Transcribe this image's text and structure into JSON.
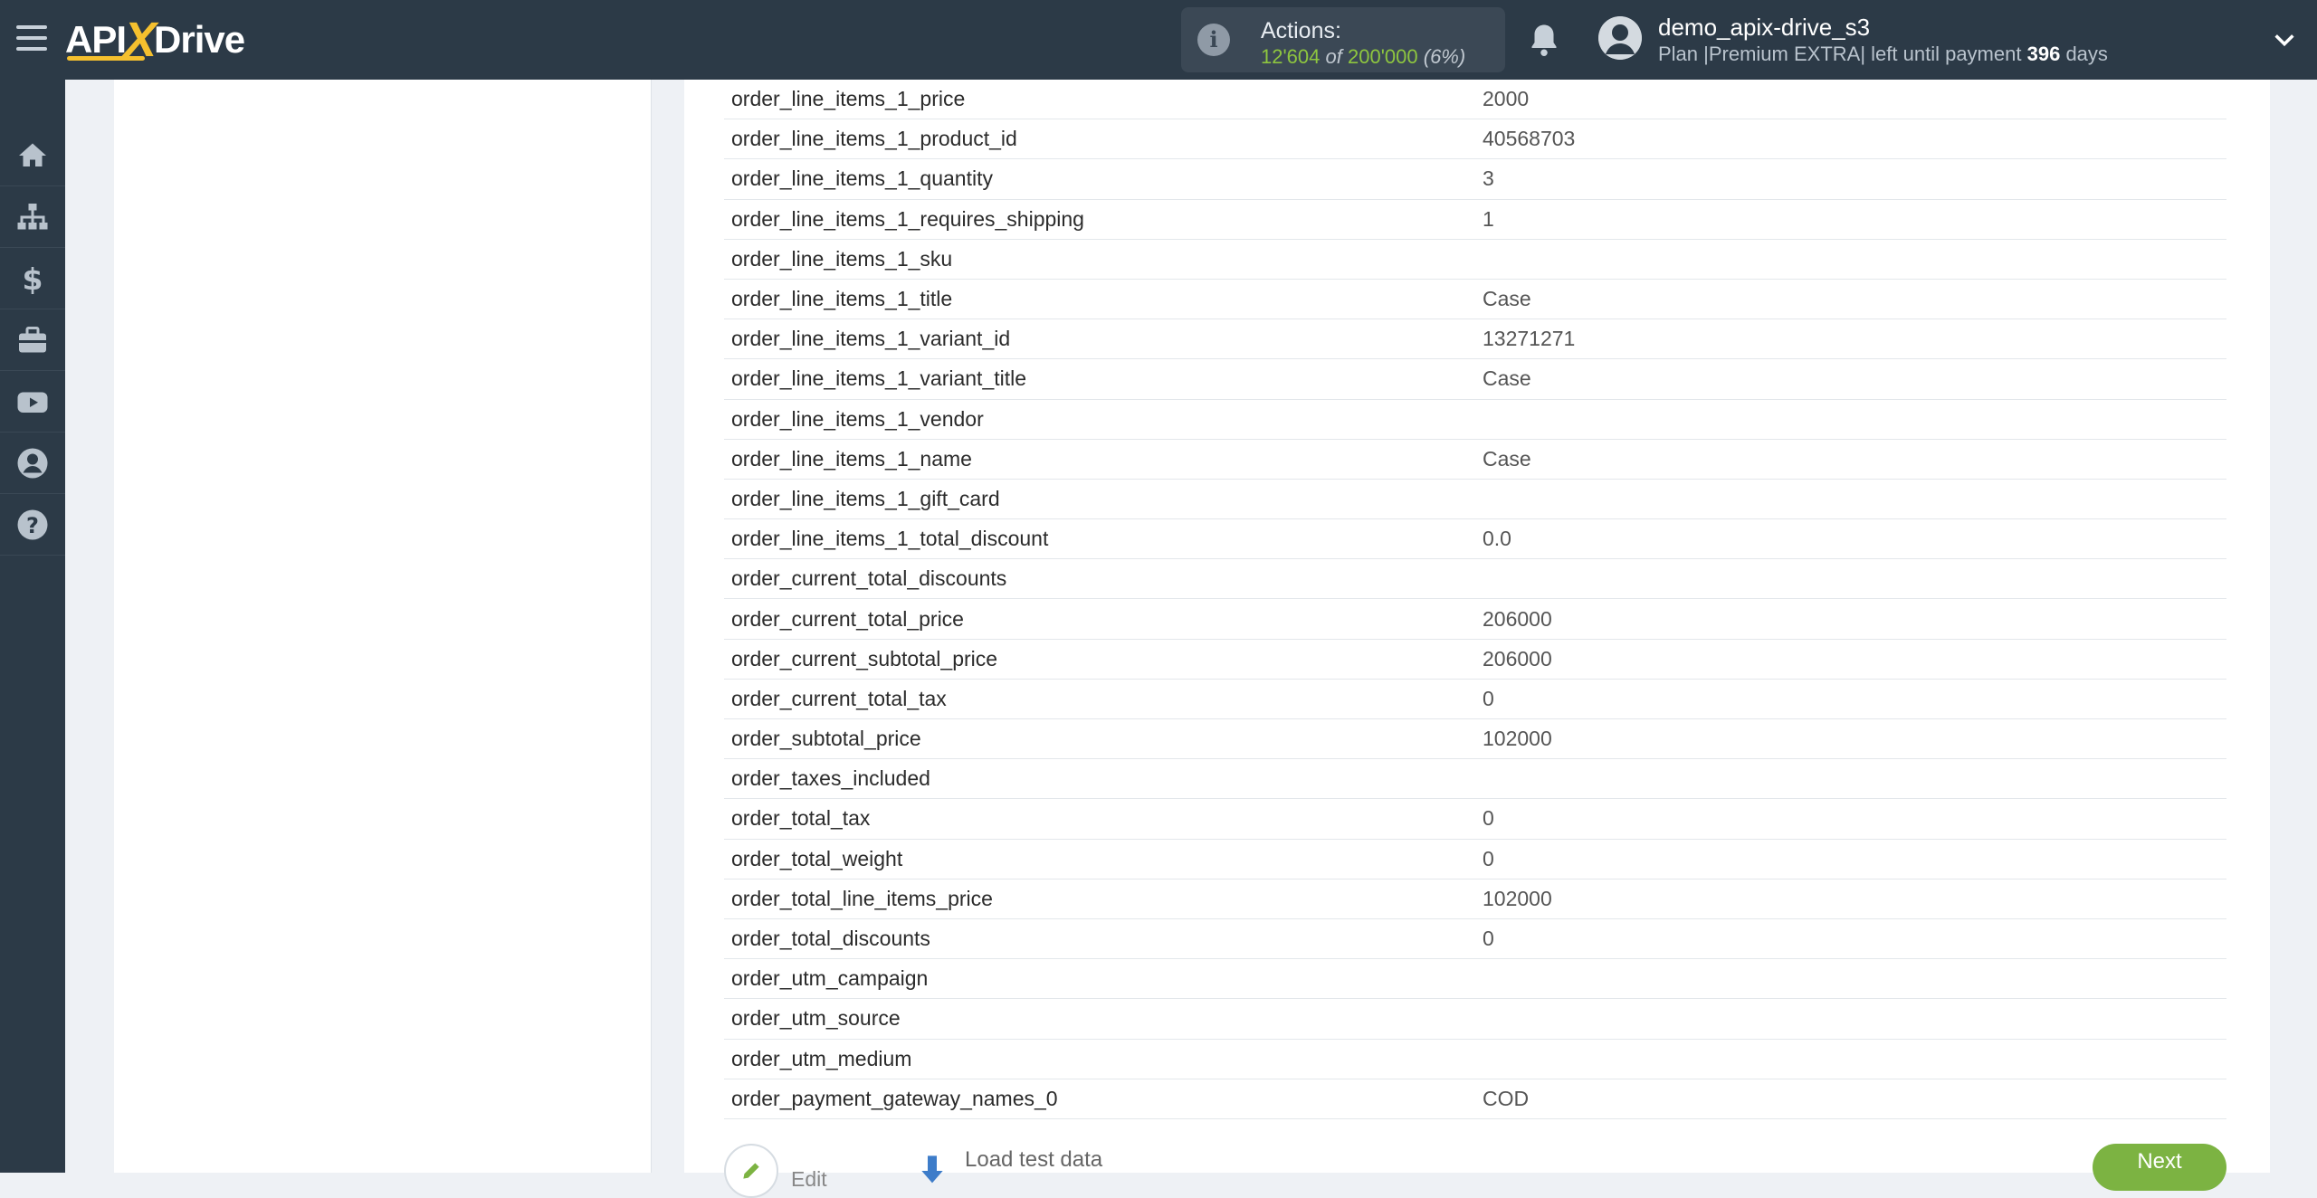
{
  "header": {
    "logo": {
      "api": "API",
      "x": "X",
      "drive": "Drive"
    },
    "actions": {
      "label": "Actions:",
      "used": "12'604",
      "of": "of",
      "total": "200'000",
      "percent": "(6%)"
    },
    "user": {
      "name": "demo_apix-drive_s3",
      "plan_prefix": "Plan |Premium EXTRA| left until payment",
      "days_left": "396",
      "days_suffix": "days"
    }
  },
  "sidebar": {
    "items": [
      {
        "icon": "home-icon"
      },
      {
        "icon": "sitemap-icon"
      },
      {
        "icon": "dollar-icon"
      },
      {
        "icon": "briefcase-icon"
      },
      {
        "icon": "youtube-icon"
      },
      {
        "icon": "user-circle-icon"
      },
      {
        "icon": "help-icon"
      }
    ]
  },
  "table": {
    "rows": [
      {
        "key": "order_line_items_1_price",
        "value": "2000"
      },
      {
        "key": "order_line_items_1_product_id",
        "value": "40568703"
      },
      {
        "key": "order_line_items_1_quantity",
        "value": "3"
      },
      {
        "key": "order_line_items_1_requires_shipping",
        "value": "1"
      },
      {
        "key": "order_line_items_1_sku",
        "value": ""
      },
      {
        "key": "order_line_items_1_title",
        "value": "Case"
      },
      {
        "key": "order_line_items_1_variant_id",
        "value": "13271271"
      },
      {
        "key": "order_line_items_1_variant_title",
        "value": "Case"
      },
      {
        "key": "order_line_items_1_vendor",
        "value": ""
      },
      {
        "key": "order_line_items_1_name",
        "value": "Case"
      },
      {
        "key": "order_line_items_1_gift_card",
        "value": ""
      },
      {
        "key": "order_line_items_1_total_discount",
        "value": "0.0"
      },
      {
        "key": "order_current_total_discounts",
        "value": ""
      },
      {
        "key": "order_current_total_price",
        "value": "206000"
      },
      {
        "key": "order_current_subtotal_price",
        "value": "206000"
      },
      {
        "key": "order_current_total_tax",
        "value": "0"
      },
      {
        "key": "order_subtotal_price",
        "value": "102000"
      },
      {
        "key": "order_taxes_included",
        "value": ""
      },
      {
        "key": "order_total_tax",
        "value": "0"
      },
      {
        "key": "order_total_weight",
        "value": "0"
      },
      {
        "key": "order_total_line_items_price",
        "value": "102000"
      },
      {
        "key": "order_total_discounts",
        "value": "0"
      },
      {
        "key": "order_utm_campaign",
        "value": ""
      },
      {
        "key": "order_utm_source",
        "value": ""
      },
      {
        "key": "order_utm_medium",
        "value": ""
      },
      {
        "key": "order_payment_gateway_names_0",
        "value": "COD"
      }
    ]
  },
  "footer": {
    "edit_label": "Edit",
    "load_label": "Load test data",
    "next_label": "Next"
  },
  "colors": {
    "accent_green": "#7cb342",
    "header_bg": "#2c3a47",
    "logo_yellow": "#f5c02e"
  }
}
